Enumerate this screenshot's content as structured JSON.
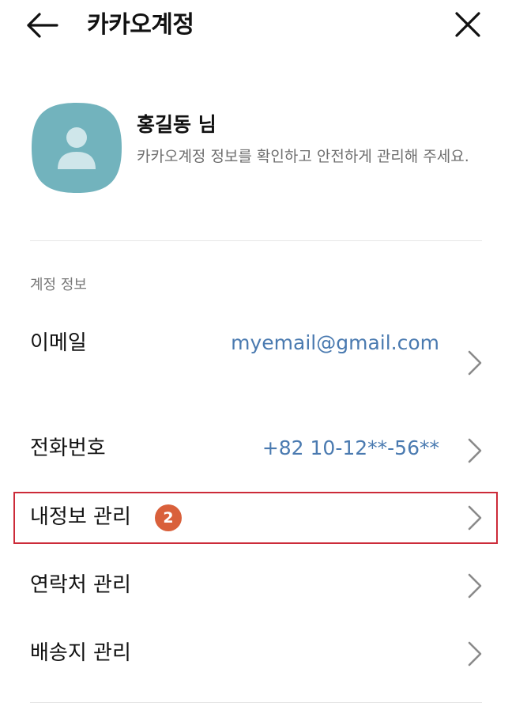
{
  "header": {
    "title": "카카오계정",
    "back_icon": "arrow-left-icon",
    "close_icon": "close-icon"
  },
  "profile": {
    "name": "홍길동 님",
    "description": "카카오계정 정보를 확인하고 안전하게 관리해 주세요.",
    "avatar_icon": "person-avatar-icon",
    "avatar_color": "#72b3bd"
  },
  "section": {
    "label": "계정 정보"
  },
  "rows": [
    {
      "label": "이메일",
      "value": "myemail@gmail.com"
    },
    {
      "label": "전화번호",
      "value": "+82 10-12**-56**"
    },
    {
      "label": "내정보 관리",
      "badge": "2"
    },
    {
      "label": "연락처 관리"
    },
    {
      "label": "배송지 관리"
    }
  ],
  "colors": {
    "value_text": "#4a7ab0",
    "badge": "#d9603b",
    "highlight_border": "#cc2b39"
  }
}
